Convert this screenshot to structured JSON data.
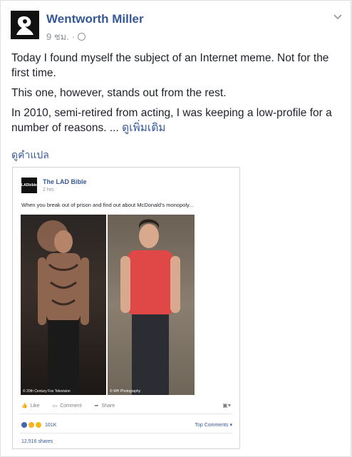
{
  "post": {
    "author": "Wentworth Miller",
    "time": "9 ชม.",
    "separator": "·",
    "paragraphs": [
      "Today I found myself the subject of an Internet meme. Not for the first time.",
      "This one, however, stands out from the rest.",
      "In 2010, semi-retired from acting, I was keeping a low-profile for a number of reasons. ..."
    ],
    "see_more": "ดูเพิ่มเติม",
    "translate": "ดูคำแปล",
    "icons": {
      "privacy": "globe-icon",
      "menu": "chevron-down-icon"
    }
  },
  "embedded": {
    "page_name": "The LAD Bible",
    "avatar_text": "LADbible",
    "time": "2 hrs",
    "caption": "When you break out of prison and find out about McDonald's monopoly...",
    "credit_left": "© 20th Century Fox Television",
    "credit_right": "© WH Photography",
    "actions": {
      "like": "Like",
      "comment": "Comment",
      "share": "Share"
    },
    "reaction_count": "101K",
    "top_comments": "Top Comments ▾",
    "shares": "12,516 shares",
    "colors": {
      "like": "#4267b2",
      "haha": "#f7b125",
      "wow": "#f0ba15"
    }
  }
}
